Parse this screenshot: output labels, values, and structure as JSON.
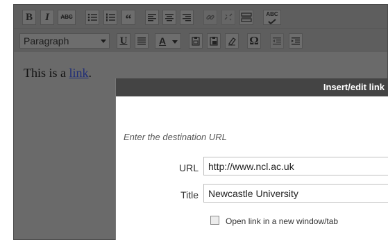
{
  "toolbar": {
    "bold_label": "B",
    "italic_label": "I",
    "strike_label": "ABC",
    "quote_label": "“",
    "format_value": "Paragraph",
    "underline_label": "U",
    "text_color_label": "A",
    "special_char_label": "Ω",
    "spellcheck_label": "ABC"
  },
  "content": {
    "text_before": "This is a ",
    "link_text": "link",
    "text_after": "."
  },
  "dialog": {
    "title": "Insert/edit link",
    "instruction": "Enter the destination URL",
    "url_label": "URL",
    "url_value": "http://www.ncl.ac.uk",
    "title_label": "Title",
    "title_value": "Newcastle University",
    "new_window_label": "Open link in a new window/tab"
  }
}
